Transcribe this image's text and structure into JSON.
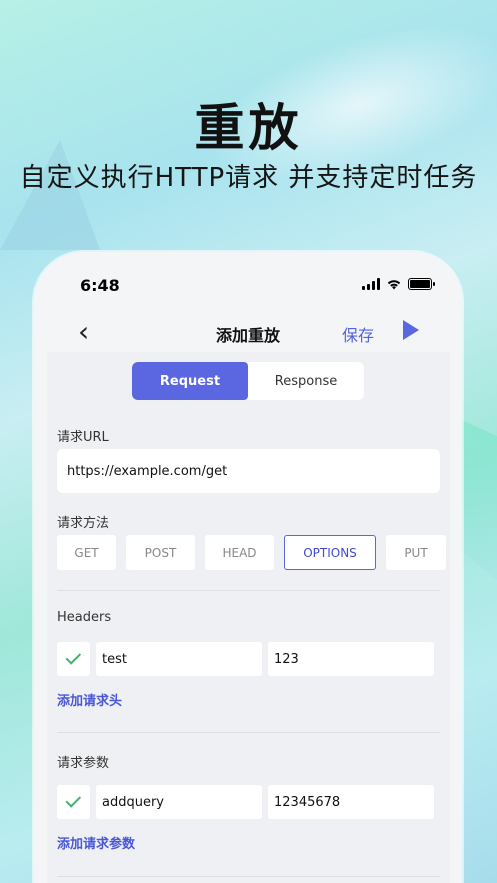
{
  "hero": {
    "title": "重放",
    "subtitle": "自定义执行HTTP请求 并支持定时任务"
  },
  "status_bar": {
    "time": "6:48"
  },
  "nav": {
    "back_icon": "chevron-left-icon",
    "title": "添加重放",
    "save_label": "保存",
    "run_icon": "play-icon"
  },
  "tabs": [
    {
      "label": "Request",
      "active": true
    },
    {
      "label": "Response",
      "active": false
    }
  ],
  "url_section": {
    "label": "请求URL",
    "value": "https://example.com/get"
  },
  "method_section": {
    "label": "请求方法",
    "options": [
      "GET",
      "POST",
      "HEAD",
      "OPTIONS",
      "PUT"
    ],
    "selected": "OPTIONS"
  },
  "headers_section": {
    "label": "Headers",
    "rows": [
      {
        "enabled": true,
        "key": "test",
        "value": "123"
      }
    ],
    "add_label": "添加请求头"
  },
  "params_section": {
    "label": "请求参数",
    "rows": [
      {
        "enabled": true,
        "key": "addquery",
        "value": "12345678"
      }
    ],
    "add_label": "添加请求参数"
  },
  "colors": {
    "accent": "#5a67e0",
    "check": "#3fb368"
  }
}
